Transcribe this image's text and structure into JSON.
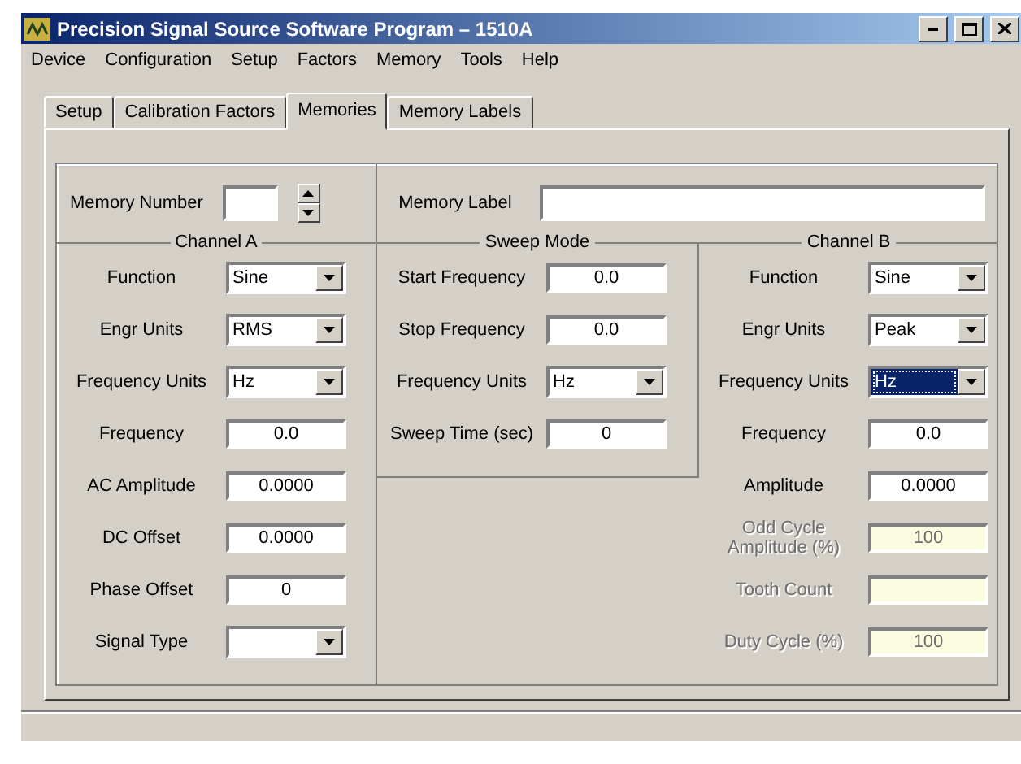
{
  "window": {
    "title": "Precision Signal Source Software Program  –  1510A"
  },
  "menu": [
    "Device",
    "Configuration",
    "Setup",
    "Factors",
    "Memory",
    "Tools",
    "Help"
  ],
  "tabs": [
    {
      "label": "Setup",
      "selected": false
    },
    {
      "label": "Calibration Factors",
      "selected": false
    },
    {
      "label": "Memories",
      "selected": true
    },
    {
      "label": "Memory Labels",
      "selected": false
    }
  ],
  "memory_number": {
    "label": "Memory Number"
  },
  "memory_label": {
    "label": "Memory Label"
  },
  "groups": [
    {
      "title": "Channel A",
      "rows": [
        {
          "kind": "select",
          "label": "Function",
          "value": "Sine",
          "disabled": false,
          "focused": false
        },
        {
          "kind": "select",
          "label": "Engr Units",
          "value": "RMS",
          "disabled": false,
          "focused": false
        },
        {
          "kind": "select",
          "label": "Frequency Units",
          "value": "Hz",
          "disabled": false,
          "focused": false
        },
        {
          "kind": "text",
          "label": "Frequency",
          "value": "0.0",
          "disabled": false
        },
        {
          "kind": "text",
          "label": "AC Amplitude",
          "value": "0.0000",
          "disabled": false
        },
        {
          "kind": "text",
          "label": "DC Offset",
          "value": "0.0000",
          "disabled": false
        },
        {
          "kind": "text",
          "label": "Phase Offset",
          "value": "0",
          "disabled": false
        },
        {
          "kind": "select",
          "label": "Signal Type",
          "disabled": false,
          "focused": false
        }
      ]
    },
    {
      "title": "Sweep Mode",
      "rows": [
        {
          "kind": "text",
          "label": "Start Frequency",
          "value": "0.0",
          "disabled": false
        },
        {
          "kind": "text",
          "label": "Stop Frequency",
          "value": "0.0",
          "disabled": false
        },
        {
          "kind": "select",
          "label": "Frequency Units",
          "value": "Hz",
          "disabled": false,
          "focused": false
        },
        {
          "kind": "text",
          "label": "Sweep Time (sec)",
          "value": "0",
          "disabled": false
        }
      ]
    },
    {
      "title": "Channel B",
      "rows": [
        {
          "kind": "select",
          "label": "Function",
          "value": "Sine",
          "disabled": false,
          "focused": false
        },
        {
          "kind": "select",
          "label": "Engr Units",
          "value": "Peak",
          "disabled": false,
          "focused": false
        },
        {
          "kind": "select",
          "label": "Frequency Units",
          "value": "Hz",
          "disabled": false,
          "focused": true
        },
        {
          "kind": "text",
          "label": "Frequency",
          "value": "0.0",
          "disabled": false
        },
        {
          "kind": "text",
          "label": "Amplitude",
          "value": "0.0000",
          "disabled": false
        },
        {
          "kind": "text",
          "label": "Odd Cycle Amplitude (%)",
          "value": "100",
          "disabled": true
        },
        {
          "kind": "text",
          "label": "Tooth Count",
          "disabled": true
        },
        {
          "kind": "text",
          "label": "Duty Cycle (%)",
          "value": "100",
          "disabled": true
        }
      ]
    }
  ]
}
